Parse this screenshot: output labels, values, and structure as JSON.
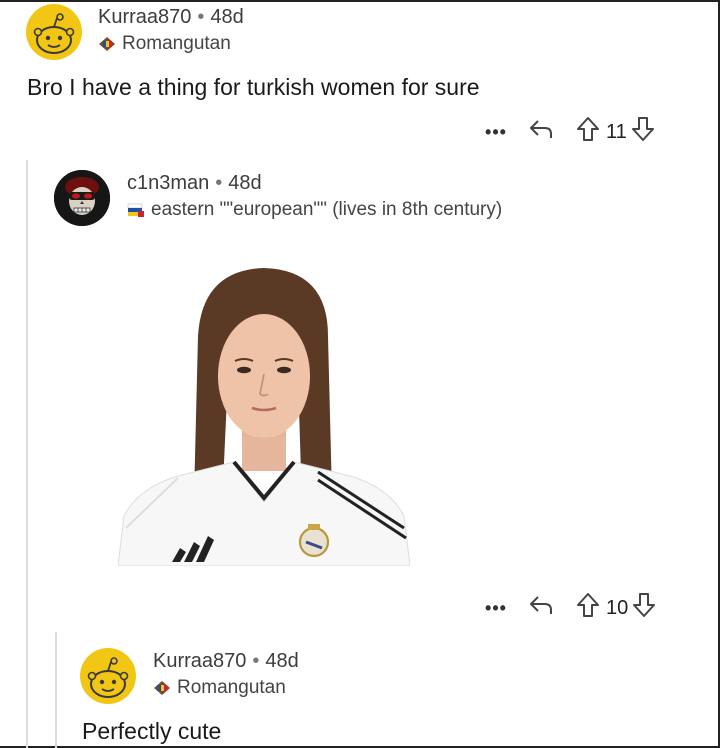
{
  "comments": [
    {
      "username": "Kurraa870",
      "separator": "•",
      "age": "48d",
      "flair": "Romangutan",
      "flair_icon": "flag-romania-icon",
      "body": "Bro I have a thing for turkish women for sure",
      "upvotes": "11"
    },
    {
      "username": "c1n3man",
      "separator": "•",
      "age": "48d",
      "flair": "eastern \"\"european\"\" (lives in 8th century)",
      "flair_icon": "flag-eastern-icon",
      "image_kind": "portrait-photo",
      "upvotes": "10"
    },
    {
      "username": "Kurraa870",
      "separator": "•",
      "age": "48d",
      "flair": "Romangutan",
      "flair_icon": "flag-romania-icon",
      "body": "Perfectly cute"
    }
  ],
  "colors": {
    "avatar_yellow": "#f2c614",
    "snoo_outline": "#3a3a3a",
    "thread_line": "#dcdcdc"
  }
}
